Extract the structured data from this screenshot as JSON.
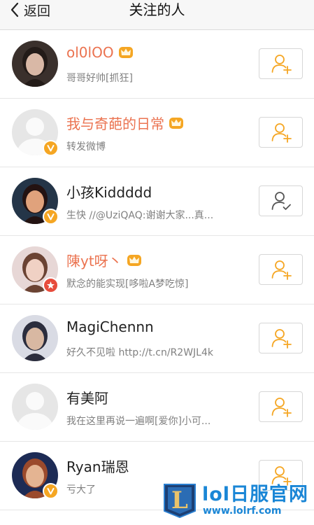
{
  "header": {
    "back_label": "返回",
    "title": "关注的人"
  },
  "users": [
    {
      "name": "ol0lOO",
      "desc": "哥哥好帅[抓狂]",
      "vip": true,
      "badge": null,
      "followed": false,
      "avatar": "photo"
    },
    {
      "name": "我与奇葩的日常",
      "desc": "转发微博",
      "vip": true,
      "badge": "verified-v",
      "followed": false,
      "avatar": "default"
    },
    {
      "name": "小孩Kiddddd",
      "desc": "生快 //@UziQAQ:谢谢大家...真...",
      "vip": false,
      "badge": "verified-v",
      "followed": true,
      "avatar": "photo"
    },
    {
      "name": "陳yt呀丶",
      "desc": "默念的能实现[哆啦A梦吃惊]",
      "vip": true,
      "badge": "red-star",
      "followed": false,
      "avatar": "photo"
    },
    {
      "name": "MagiChennn",
      "desc": "好久不见啦 http://t.cn/R2WJL4k",
      "vip": false,
      "badge": null,
      "followed": false,
      "avatar": "photo"
    },
    {
      "name": "有美阿",
      "desc": "我在这里再说一遍啊[爱你]小可...",
      "vip": false,
      "badge": null,
      "followed": false,
      "avatar": "default"
    },
    {
      "name": "Ryan瑞恩",
      "desc": "亏大了",
      "vip": false,
      "badge": "verified-v",
      "followed": false,
      "avatar": "photo"
    }
  ],
  "watermark": {
    "title": "lol日服官网",
    "url": "www.lolrf.com",
    "logo_letter": "L"
  },
  "colors": {
    "accent": "#f5a623",
    "vip_name": "#eb7350",
    "followed_icon": "#555555",
    "watermark": "#1a86d6"
  }
}
